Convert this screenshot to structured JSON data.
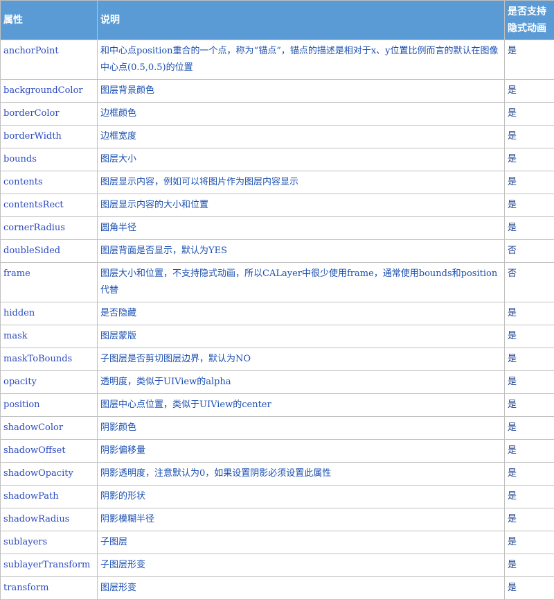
{
  "headers": [
    "属性",
    "说明",
    "是否支持隐式动画"
  ],
  "rows": [
    [
      "anchorPoint",
      "和中心点position重合的一个点，称为“锚点”，锚点的描述是相对于x、y位置比例而言的默认在图像中心点(0.5,0.5)的位置",
      "是"
    ],
    [
      "backgroundColor",
      "图层背景颜色",
      "是"
    ],
    [
      "borderColor",
      "边框颜色",
      "是"
    ],
    [
      "borderWidth",
      "边框宽度",
      "是"
    ],
    [
      "bounds",
      "图层大小",
      "是"
    ],
    [
      "contents",
      "图层显示内容，例如可以将图片作为图层内容显示",
      "是"
    ],
    [
      "contentsRect",
      "图层显示内容的大小和位置",
      "是"
    ],
    [
      "cornerRadius",
      "圆角半径",
      "是"
    ],
    [
      "doubleSided",
      "图层背面是否显示，默认为YES",
      "否"
    ],
    [
      "frame",
      "图层大小和位置，不支持隐式动画，所以CALayer中很少使用frame，通常使用bounds和position代替",
      "否"
    ],
    [
      "hidden",
      "是否隐藏",
      "是"
    ],
    [
      "mask",
      "图层蒙版",
      "是"
    ],
    [
      "maskToBounds",
      "子图层是否剪切图层边界，默认为NO",
      "是"
    ],
    [
      "opacity",
      "透明度，类似于UIView的alpha",
      "是"
    ],
    [
      "position",
      "图层中心点位置，类似于UIView的center",
      "是"
    ],
    [
      "shadowColor",
      "阴影颜色",
      "是"
    ],
    [
      "shadowOffset",
      "阴影偏移量",
      "是"
    ],
    [
      "shadowOpacity",
      "阴影透明度，注意默认为0，如果设置阴影必须设置此属性",
      "是"
    ],
    [
      "shadowPath",
      "阴影的形状",
      "是"
    ],
    [
      "shadowRadius",
      "阴影模糊半径",
      "是"
    ],
    [
      "sublayers",
      "子图层",
      "是"
    ],
    [
      "sublayerTransform",
      "子图层形变",
      "是"
    ],
    [
      "transform",
      "图层形变",
      "是"
    ]
  ]
}
